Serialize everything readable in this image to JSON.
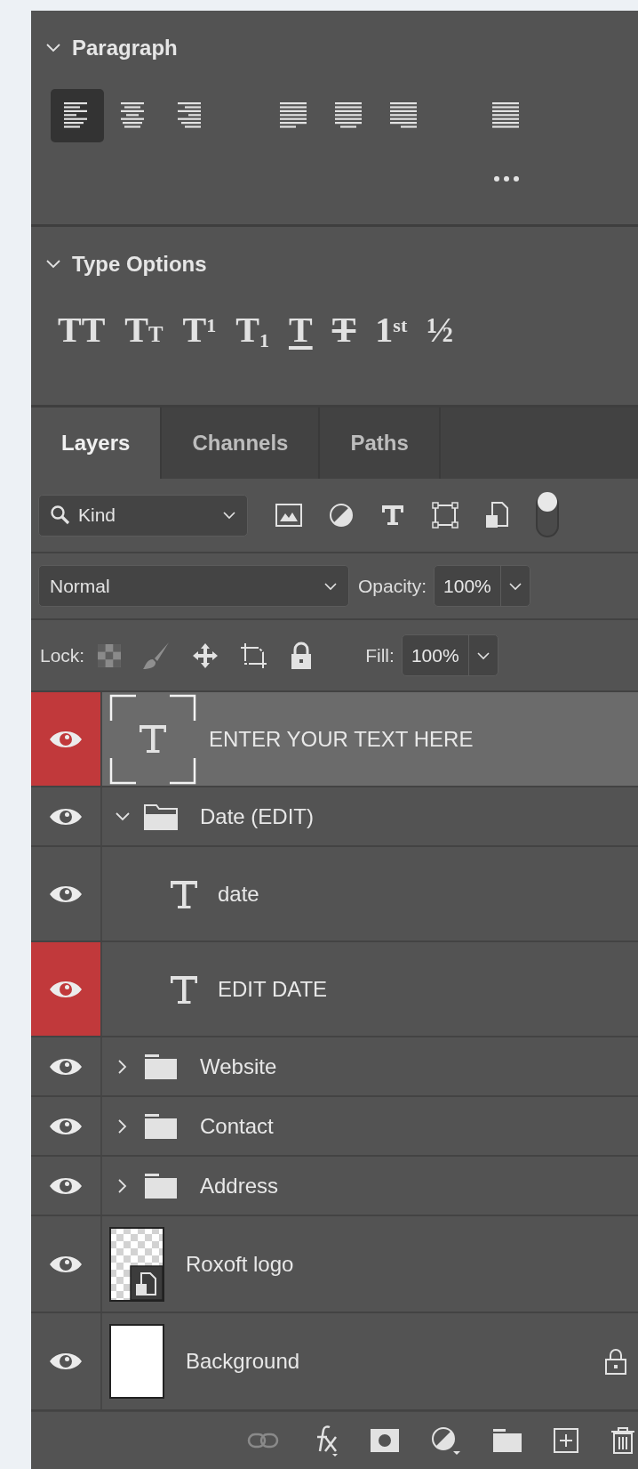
{
  "paragraph": {
    "title": "Paragraph",
    "expanded": true,
    "alignments": [
      {
        "kind": "left",
        "selected": true
      },
      {
        "kind": "center",
        "selected": false
      },
      {
        "kind": "right",
        "selected": false
      },
      {
        "kind": "justify-left",
        "selected": false
      },
      {
        "kind": "justify-center",
        "selected": false
      },
      {
        "kind": "justify-right",
        "selected": false
      },
      {
        "kind": "justify-all",
        "selected": false
      }
    ]
  },
  "type_options": {
    "title": "Type Options",
    "expanded": true,
    "styles": [
      {
        "kind": "all-caps",
        "text": "TT"
      },
      {
        "kind": "small-caps",
        "text": "T",
        "small": "T"
      },
      {
        "kind": "superscript",
        "text": "T$^{1}$"
      },
      {
        "kind": "subscript",
        "text": "T$_{1}$"
      },
      {
        "kind": "underline",
        "text": "T"
      },
      {
        "kind": "strikethrough",
        "text": "T"
      },
      {
        "kind": "ordinals",
        "text": "1$^{st}$"
      },
      {
        "kind": "fractions",
        "text": "½"
      }
    ]
  },
  "layers_panel": {
    "tabs": [
      {
        "label": "Layers",
        "selected": true
      },
      {
        "label": "Channels",
        "selected": false
      },
      {
        "label": "Paths",
        "selected": false
      }
    ],
    "filter": {
      "value": "Kind",
      "enabled": true
    },
    "blend_mode": "Normal",
    "opacity": {
      "label": "Opacity:",
      "value": "100%"
    },
    "lock": {
      "label": "Lock:"
    },
    "fill": {
      "label": "Fill:",
      "value": "100%"
    },
    "layers": [
      {
        "kind": "text",
        "name": "ENTER YOUR TEXT HERE",
        "visible": true,
        "selected": true,
        "color": "#c1393b"
      },
      {
        "kind": "group",
        "name": "Date (EDIT)",
        "visible": true,
        "selected": false,
        "expanded": true,
        "children": [
          {
            "kind": "text",
            "name": "date",
            "visible": true,
            "selected": false
          },
          {
            "kind": "text",
            "name": "EDIT DATE",
            "visible": true,
            "selected": false,
            "color": "#c1393b"
          }
        ]
      },
      {
        "kind": "group",
        "name": "Website",
        "visible": true,
        "selected": false,
        "expanded": false
      },
      {
        "kind": "group",
        "name": "Contact",
        "visible": true,
        "selected": false,
        "expanded": false
      },
      {
        "kind": "group",
        "name": "Address",
        "visible": true,
        "selected": false,
        "expanded": false
      },
      {
        "kind": "smart",
        "name": "Roxoft logo",
        "visible": true,
        "selected": false
      },
      {
        "kind": "pixel",
        "name": "Background",
        "visible": true,
        "selected": false,
        "locked": true
      }
    ]
  }
}
